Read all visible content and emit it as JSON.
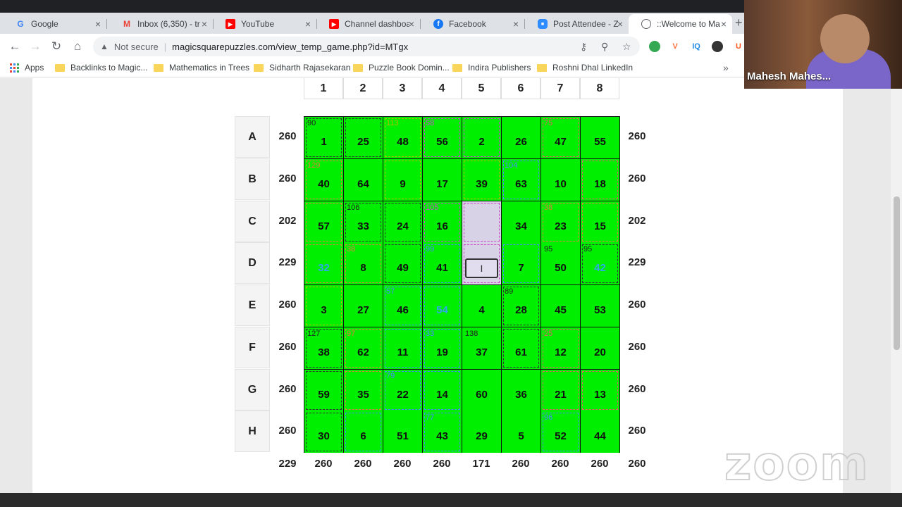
{
  "browser": {
    "tabs": [
      {
        "title": "Google",
        "favicon": "google-icon",
        "color": "#4285f4",
        "active": false
      },
      {
        "title": "Inbox (6,350) - tr",
        "favicon": "gmail-icon",
        "color": "#ea4335",
        "active": false
      },
      {
        "title": "YouTube",
        "favicon": "youtube-icon",
        "color": "#ff0000",
        "active": false
      },
      {
        "title": "Channel dashboa",
        "favicon": "youtube-icon",
        "color": "#ff0000",
        "active": false
      },
      {
        "title": "Facebook",
        "favicon": "facebook-icon",
        "color": "#1877f2",
        "active": false
      },
      {
        "title": "Post Attendee - Z",
        "favicon": "zoom-icon",
        "color": "#2d8cff",
        "active": false
      },
      {
        "title": "::Welcome to Ma",
        "favicon": "globe-icon",
        "color": "#5f6368",
        "active": true
      }
    ],
    "security_text": "Not secure",
    "url": "magicsquarepuzzles.com/view_temp_game.php?id=MTgx",
    "extensions": [
      {
        "name": "ext-globe-icon",
        "label": "",
        "color": "#34a853"
      },
      {
        "name": "ext-v-icon",
        "label": "V",
        "color": "#ff7043"
      },
      {
        "name": "ext-iq-icon",
        "label": "IQ",
        "color": "#1e88e5"
      },
      {
        "name": "ext-circle-icon",
        "label": "",
        "color": "#333333"
      },
      {
        "name": "ext-u-icon",
        "label": "U",
        "color": "#ff5722"
      }
    ],
    "bookmarks": [
      "Apps",
      "Backlinks to Magic...",
      "Mathematics in Trees",
      "Sidharth Rajasekaran",
      "Puzzle Book Domin...",
      "Indira Publishers",
      "Roshni Dhal LinkedIn"
    ]
  },
  "puzzle": {
    "columns": [
      "1",
      "2",
      "3",
      "4",
      "5",
      "6",
      "7",
      "8"
    ],
    "rows": [
      {
        "label": "A",
        "left_sum": "260",
        "right_sum": "260"
      },
      {
        "label": "B",
        "left_sum": "260",
        "right_sum": "260"
      },
      {
        "label": "C",
        "left_sum": "202",
        "right_sum": "202"
      },
      {
        "label": "D",
        "left_sum": "229",
        "right_sum": "229"
      },
      {
        "label": "E",
        "left_sum": "260",
        "right_sum": "260"
      },
      {
        "label": "F",
        "left_sum": "260",
        "right_sum": "260"
      },
      {
        "label": "G",
        "left_sum": "260",
        "right_sum": "260"
      },
      {
        "label": "H",
        "left_sum": "260",
        "right_sum": "260"
      }
    ],
    "cells": [
      [
        {
          "v": "1",
          "c": "90",
          "b": "#333333"
        },
        {
          "v": "25",
          "c": "",
          "b": "#333333"
        },
        {
          "v": "48",
          "c": "113",
          "b": "#b8b800"
        },
        {
          "v": "56",
          "c": "58",
          "b": "#cc44cc"
        },
        {
          "v": "2",
          "c": "",
          "b": "#cc44cc"
        },
        {
          "v": "26",
          "c": "",
          "b": ""
        },
        {
          "v": "47",
          "c": "75",
          "b": "#e06060"
        },
        {
          "v": "55",
          "c": "",
          "b": ""
        }
      ],
      [
        {
          "v": "40",
          "c": "129",
          "b": "#e08040"
        },
        {
          "v": "64",
          "c": "",
          "b": ""
        },
        {
          "v": "9",
          "c": "",
          "b": "#b8b800"
        },
        {
          "v": "17",
          "c": "",
          "b": ""
        },
        {
          "v": "39",
          "c": "",
          "b": "#b8b800"
        },
        {
          "v": "63",
          "c": "104",
          "b": "#4488ff"
        },
        {
          "v": "10",
          "c": "",
          "b": ""
        },
        {
          "v": "18",
          "c": "",
          "b": "#e06060"
        }
      ],
      [
        {
          "v": "57",
          "c": "",
          "b": "#e08040"
        },
        {
          "v": "33",
          "c": "106",
          "b": "#333333"
        },
        {
          "v": "24",
          "c": "",
          "b": "#333333"
        },
        {
          "v": "16",
          "c": "105",
          "b": "#cc44cc"
        },
        {
          "v": "",
          "c": "",
          "b": "#cc44cc",
          "empty": true
        },
        {
          "v": "34",
          "c": "",
          "b": ""
        },
        {
          "v": "23",
          "c": "38",
          "b": "#e08040"
        },
        {
          "v": "15",
          "c": "",
          "b": "#e08040"
        }
      ],
      [
        {
          "v": "32",
          "c": "",
          "b": "#e08040",
          "vc": "#2ea8e8"
        },
        {
          "v": "8",
          "c": "38",
          "b": "#e08040"
        },
        {
          "v": "49",
          "c": "",
          "b": "#333333"
        },
        {
          "v": "41",
          "c": "99",
          "b": "#4488ff"
        },
        {
          "v": "",
          "c": "",
          "b": "#cc44cc",
          "empty": true,
          "input": true
        },
        {
          "v": "7",
          "c": "",
          "b": "#4488ff"
        },
        {
          "v": "50",
          "c": "95",
          "b": ""
        },
        {
          "v": "42",
          "c": "95",
          "b": "#333333",
          "vc": "#2ea8e8"
        }
      ],
      [
        {
          "v": "3",
          "c": "",
          "b": "#b8b800"
        },
        {
          "v": "27",
          "c": "",
          "b": ""
        },
        {
          "v": "46",
          "c": "57",
          "b": "#4488ff"
        },
        {
          "v": "54",
          "c": "",
          "b": "#4488ff",
          "vc": "#2ea8e8"
        },
        {
          "v": "4",
          "c": "",
          "b": ""
        },
        {
          "v": "28",
          "c": "89",
          "b": "#333333"
        },
        {
          "v": "45",
          "c": "",
          "b": ""
        },
        {
          "v": "53",
          "c": "",
          "b": ""
        }
      ],
      [
        {
          "v": "38",
          "c": "127",
          "b": "#333333"
        },
        {
          "v": "62",
          "c": "97",
          "b": "#e08040"
        },
        {
          "v": "11",
          "c": "",
          "b": "#4488ff"
        },
        {
          "v": "19",
          "c": "33",
          "b": "#4488ff"
        },
        {
          "v": "37",
          "c": "138",
          "b": ""
        },
        {
          "v": "61",
          "c": "",
          "b": "#333333"
        },
        {
          "v": "12",
          "c": "25",
          "b": "#e06060"
        },
        {
          "v": "20",
          "c": "",
          "b": ""
        }
      ],
      [
        {
          "v": "59",
          "c": "",
          "b": "#333333"
        },
        {
          "v": "35",
          "c": "",
          "b": "#e08040"
        },
        {
          "v": "22",
          "c": "79",
          "b": "#4488ff"
        },
        {
          "v": "14",
          "c": "",
          "b": "#4488ff"
        },
        {
          "v": "60",
          "c": "",
          "b": ""
        },
        {
          "v": "36",
          "c": "",
          "b": ""
        },
        {
          "v": "21",
          "c": "",
          "b": "#e06060"
        },
        {
          "v": "13",
          "c": "",
          "b": "#e06060"
        }
      ],
      [
        {
          "v": "30",
          "c": "",
          "b": "#333333"
        },
        {
          "v": "6",
          "c": "",
          "b": "#4488ff"
        },
        {
          "v": "51",
          "c": "",
          "b": ""
        },
        {
          "v": "43",
          "c": "77",
          "b": "#4488ff"
        },
        {
          "v": "29",
          "c": "",
          "b": ""
        },
        {
          "v": "5",
          "c": "",
          "b": ""
        },
        {
          "v": "52",
          "c": "96",
          "b": "#4488ff"
        },
        {
          "v": "44",
          "c": "",
          "b": ""
        }
      ]
    ],
    "diag_sum_left": "229",
    "column_sums": [
      "260",
      "260",
      "260",
      "260",
      "171",
      "260",
      "260",
      "260"
    ],
    "diag_sum_right": "260",
    "cage_number_colors": {
      "default": "#222222"
    }
  },
  "zoom": {
    "participant_name": "Mahesh Mahes...",
    "logo_text": "zoom"
  }
}
